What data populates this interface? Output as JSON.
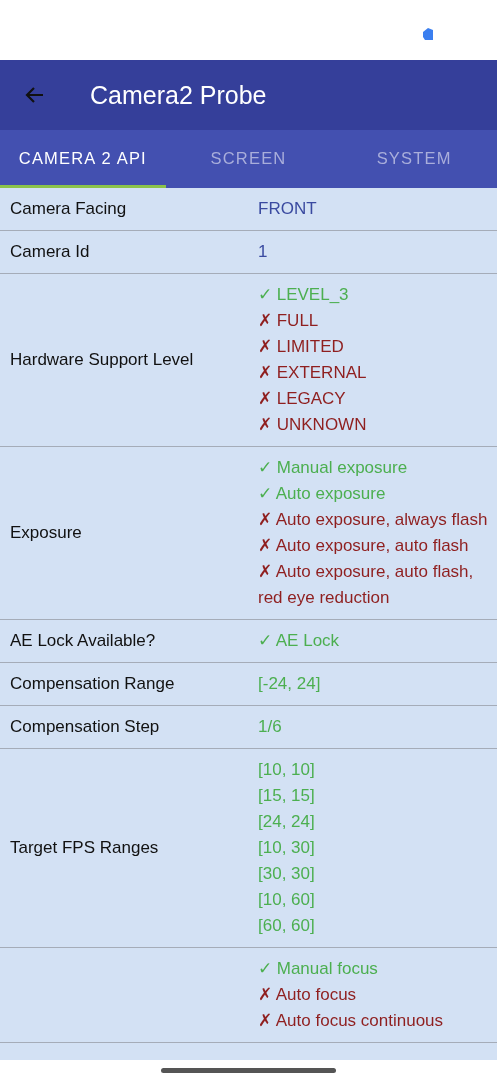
{
  "app_bar": {
    "title": "Camera2 Probe"
  },
  "tabs": [
    {
      "label": "CAMERA 2 API",
      "selected": true
    },
    {
      "label": "SCREEN",
      "selected": false
    },
    {
      "label": "SYSTEM",
      "selected": false
    }
  ],
  "rows": [
    {
      "label": "Camera Facing",
      "values": [
        {
          "text": "FRONT",
          "kind": "info"
        }
      ]
    },
    {
      "label": "Camera Id",
      "values": [
        {
          "text": "1",
          "kind": "info"
        }
      ]
    },
    {
      "label": "Hardware Support Level",
      "values": [
        {
          "text": "✓ LEVEL_3",
          "kind": "yes"
        },
        {
          "text": "✗ FULL",
          "kind": "no"
        },
        {
          "text": "✗ LIMITED",
          "kind": "no"
        },
        {
          "text": "✗ EXTERNAL",
          "kind": "no"
        },
        {
          "text": "✗ LEGACY",
          "kind": "no"
        },
        {
          "text": "✗ UNKNOWN",
          "kind": "no"
        }
      ]
    },
    {
      "label": "Exposure",
      "values": [
        {
          "text": "✓ Manual exposure",
          "kind": "yes"
        },
        {
          "text": "✓ Auto exposure",
          "kind": "yes"
        },
        {
          "text": "✗ Auto exposure, always flash",
          "kind": "no"
        },
        {
          "text": "✗ Auto exposure, auto flash",
          "kind": "no"
        },
        {
          "text": "✗ Auto exposure, auto flash, red eye reduction",
          "kind": "no"
        }
      ]
    },
    {
      "label": "AE Lock Available?",
      "values": [
        {
          "text": "✓ AE Lock",
          "kind": "yes"
        }
      ]
    },
    {
      "label": "Compensation Range",
      "values": [
        {
          "text": "[-24, 24]",
          "kind": "yes"
        }
      ]
    },
    {
      "label": "Compensation Step",
      "values": [
        {
          "text": "1/6",
          "kind": "yes"
        }
      ]
    },
    {
      "label": "Target FPS Ranges",
      "values": [
        {
          "text": "[10, 10]",
          "kind": "yes"
        },
        {
          "text": "[15, 15]",
          "kind": "yes"
        },
        {
          "text": "[24, 24]",
          "kind": "yes"
        },
        {
          "text": "[10, 30]",
          "kind": "yes"
        },
        {
          "text": "[30, 30]",
          "kind": "yes"
        },
        {
          "text": "[10, 60]",
          "kind": "yes"
        },
        {
          "text": "[60, 60]",
          "kind": "yes"
        }
      ]
    },
    {
      "values": [
        {
          "text": "✓ Manual focus",
          "kind": "yes"
        },
        {
          "text": "✗ Auto focus",
          "kind": "no"
        },
        {
          "text": "✗ Auto focus continuous",
          "kind": "no"
        }
      ]
    }
  ]
}
